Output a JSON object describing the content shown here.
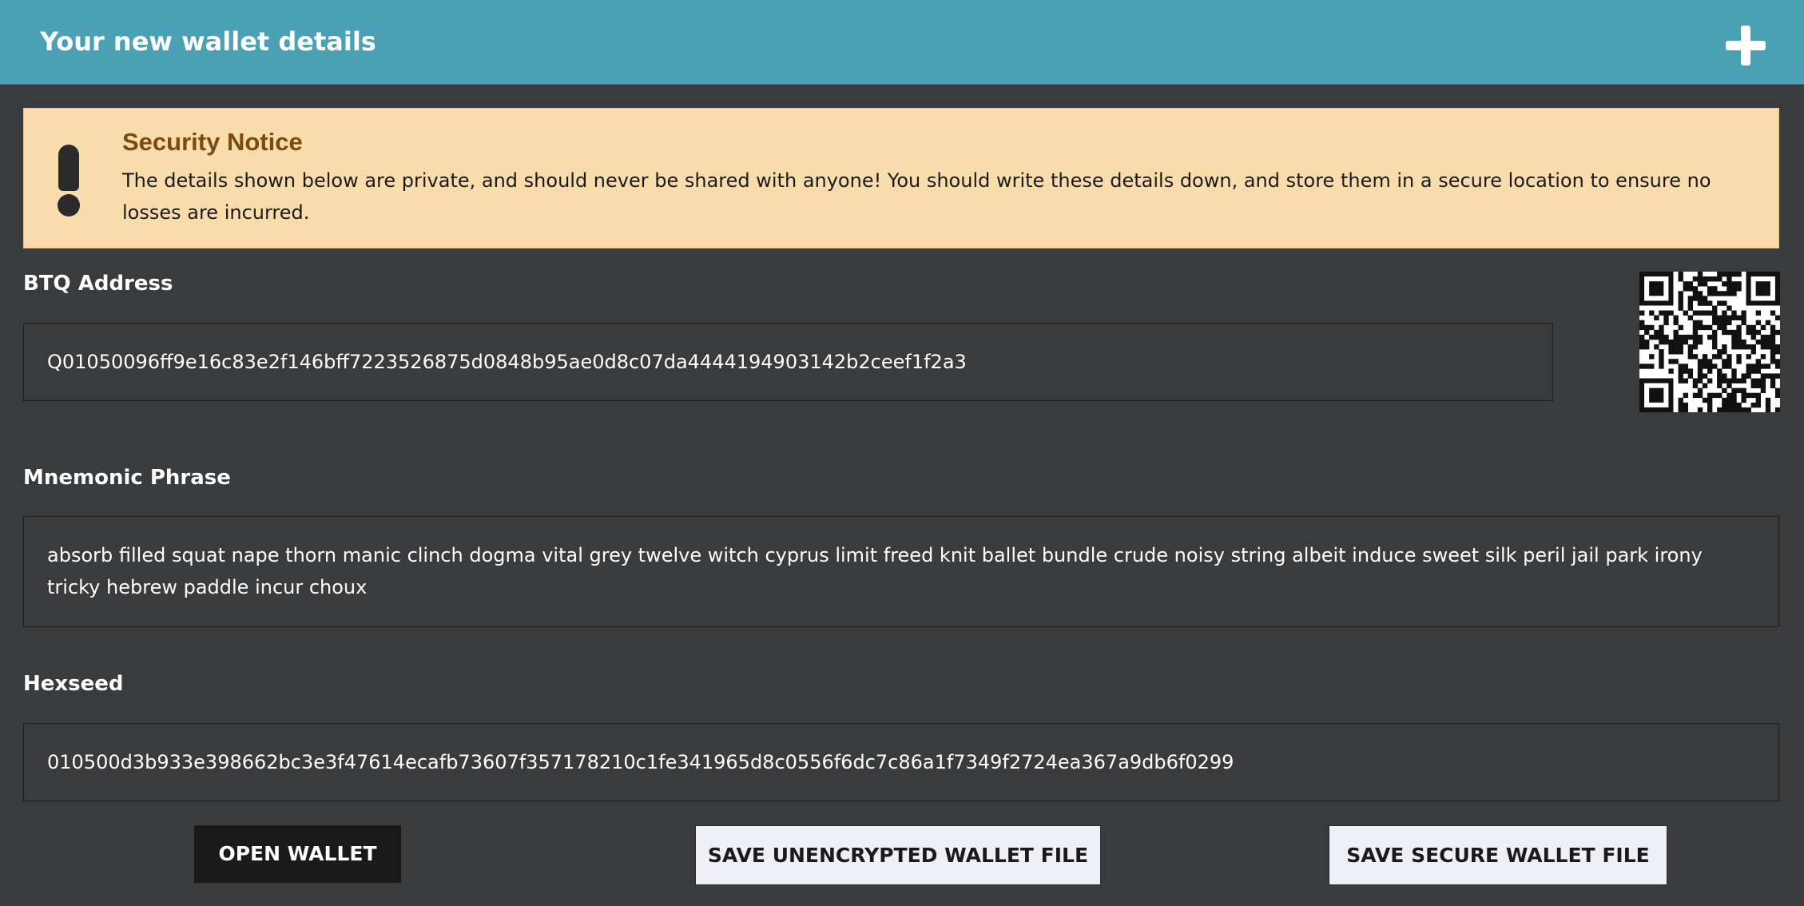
{
  "header": {
    "title": "Your new wallet details",
    "toggle_icon": "plus-icon"
  },
  "notice": {
    "icon": "exclamation-icon",
    "title": "Security Notice",
    "text": "The details shown below are private, and should never be shared with anyone! You should write these details down, and store them in a secure location to ensure no losses are incurred."
  },
  "address": {
    "label": "BTQ Address",
    "value": "Q01050096ff9e16c83e2f146bff7223526875d0848b95ae0d8c07da4444194903142b2ceef1f2a3"
  },
  "mnemonic": {
    "label": "Mnemonic Phrase",
    "value": "absorb filled squat nape thorn manic clinch dogma vital grey twelve witch cyprus limit freed knit ballet bundle crude noisy string albeit induce sweet silk peril jail park irony tricky hebrew paddle incur choux"
  },
  "hexseed": {
    "label": "Hexseed",
    "value": "010500d3b933e398662bc3e3f47614ecafb73607f357178210c1fe341965d8c0556f6dc7c86a1f7349f2724ea367a9db6f0299"
  },
  "buttons": {
    "open_wallet": "OPEN WALLET",
    "save_unencrypted": "SAVE UNENCRYPTED WALLET FILE",
    "save_secure": "SAVE SECURE WALLET FILE"
  },
  "colors": {
    "header_bg": "#4aa0b5",
    "page_bg": "#3a3b3d",
    "notice_bg": "#f9dcab",
    "notice_title": "#7a4a10",
    "button_dark": "#1a1a1a",
    "button_light": "#eef0f6"
  }
}
